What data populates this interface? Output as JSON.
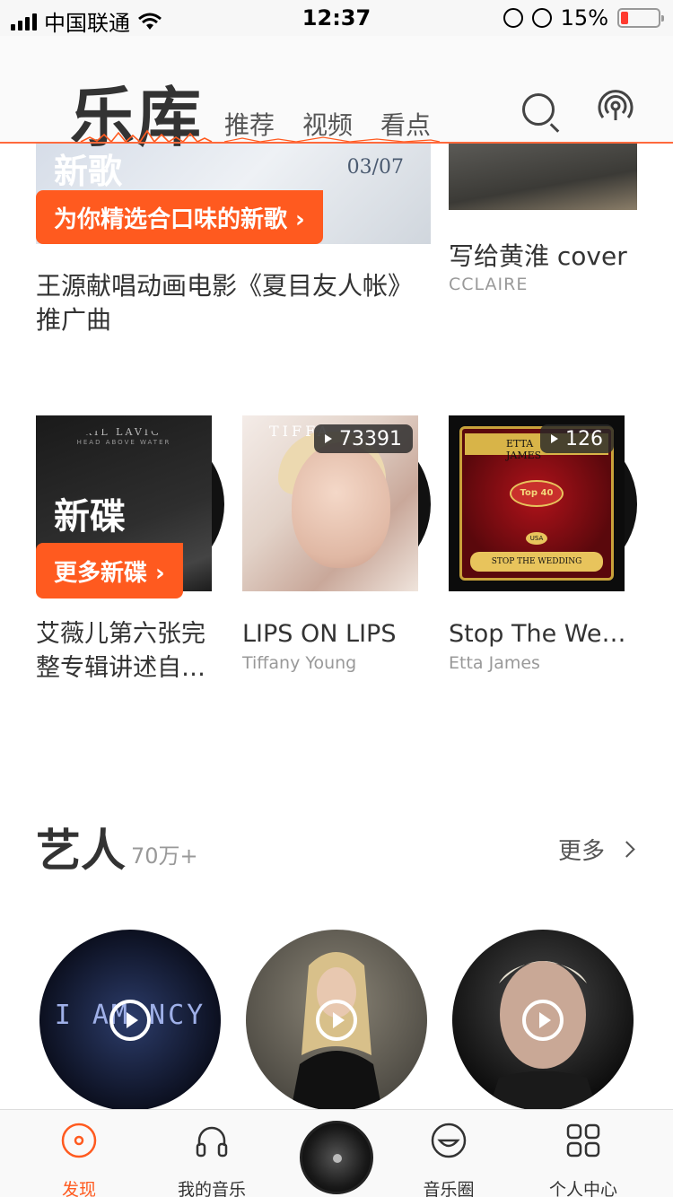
{
  "status_bar": {
    "carrier": "中国联通",
    "time": "12:37",
    "battery": "15%"
  },
  "header": {
    "title": "乐库",
    "tabs": [
      {
        "label": "推荐"
      },
      {
        "label": "视频"
      },
      {
        "label": "看点"
      }
    ]
  },
  "top_row": [
    {
      "banner_label": "新歌",
      "date": "03/07",
      "cta": "为你精选合口味的新歌 ›",
      "title": "王源献唱动画电影《夏目友人帐》推广曲"
    },
    {
      "title": "写给黄淮 cover",
      "subtitle": "CCLAIRE"
    }
  ],
  "albums": [
    {
      "cover_artist": "AVRIL LAVIGNE",
      "cover_subtitle": "HEAD ABOVE WATER",
      "overlay_label": "新碟",
      "cta": "更多新碟 ›",
      "title": "艾薇儿第六张完整专辑讲述自…",
      "subtitle": ""
    },
    {
      "cover_text": "TIFFA",
      "play_count": "73391",
      "title": "LIPS ON LIPS",
      "subtitle": "Tiffany Young"
    },
    {
      "cover_name": "ETTA JAMES",
      "cover_badge": "Top 40",
      "cover_country": "USA",
      "cover_song": "STOP THE WEDDING",
      "play_count": "126",
      "title": "Stop The We…",
      "subtitle": "Etta James"
    }
  ],
  "artists_section": {
    "title": "艺人",
    "count": "70万+",
    "more": "更多",
    "artists": [
      {
        "image_text": "I AM NCY"
      },
      {
        "image_text": ""
      },
      {
        "image_text": ""
      }
    ]
  },
  "tab_bar": {
    "items": [
      {
        "label": "发现",
        "icon": "disc-icon",
        "active": true
      },
      {
        "label": "我的音乐",
        "icon": "headphones-icon"
      },
      {
        "label": "",
        "icon": "now-playing-disc"
      },
      {
        "label": "音乐圈",
        "icon": "smile-icon"
      },
      {
        "label": "个人中心",
        "icon": "grid-icon"
      }
    ]
  },
  "colors": {
    "accent": "#ff5a1f"
  }
}
